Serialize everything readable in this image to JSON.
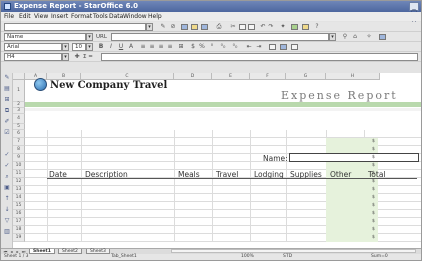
{
  "window": {
    "title": "Expense Report - StarOffice 6.0",
    "controls_label": "_ □ ×"
  },
  "menu": [
    "File",
    "Edit",
    "View",
    "Insert",
    "Format",
    "Tools",
    "Data",
    "Window",
    "Help"
  ],
  "toolbar": {
    "load_url": "",
    "font_name": "Name",
    "url_label": "URL",
    "font_family": "Arial",
    "font_size": "10",
    "cell_ref": "H4",
    "formula_symbols": "Σ ="
  },
  "sheet": {
    "columns": [
      "A",
      "B",
      "C",
      "D",
      "E",
      "F",
      "G",
      "H"
    ],
    "rows": [
      "1",
      "2",
      "3",
      "4",
      "5",
      "6",
      "7",
      "8",
      "9",
      "10",
      "11",
      "12",
      "13",
      "14",
      "15",
      "16",
      "17",
      "18",
      "19"
    ],
    "company": "New Company Travel",
    "report_title": "Expense Report",
    "name_label": "Name:",
    "headers": [
      "Date",
      "Description",
      "Meals",
      "Travel",
      "Lodging",
      "Supplies",
      "Other",
      "Total"
    ],
    "total_symbol": "$"
  },
  "tabs": [
    "Sheet1",
    "Sheet2",
    "Sheet3"
  ],
  "status": {
    "sheet": "Sheet 1 / 3",
    "page_style": "Tab_Sheet1",
    "zoom": "100%",
    "mode": "STD",
    "sum": "Sum=0"
  },
  "colors": {
    "band": "#b9d9ad",
    "total_col": "#e6f2dc",
    "titlebar": "#5a72a8"
  }
}
